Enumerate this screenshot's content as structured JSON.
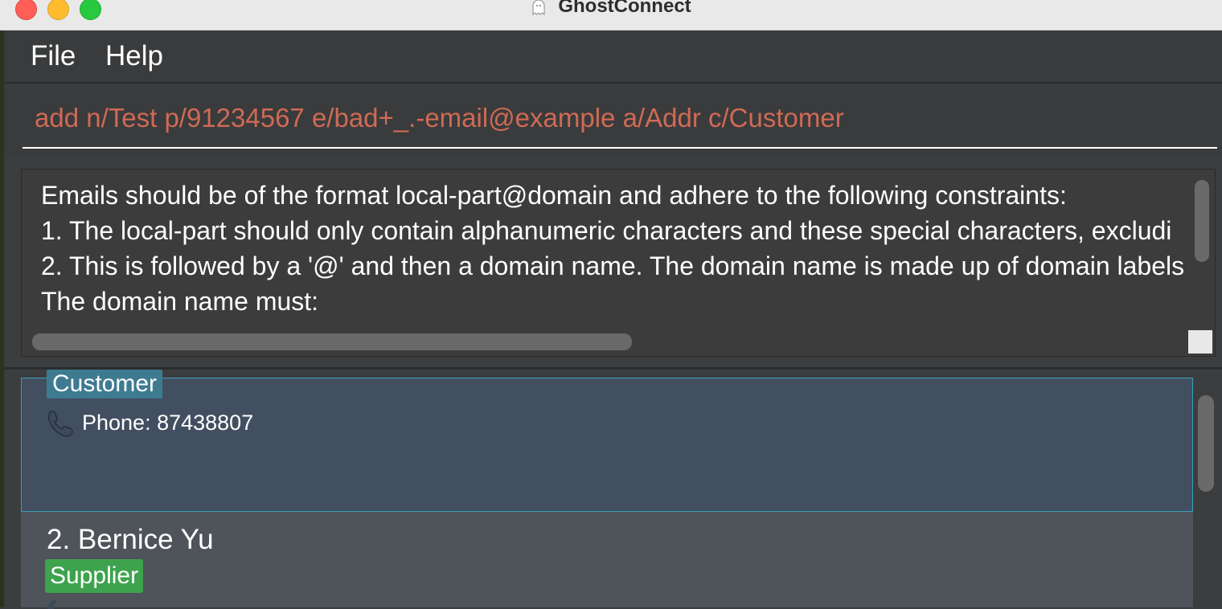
{
  "window": {
    "title": "GhostConnect"
  },
  "menu": {
    "file": "File",
    "help": "Help"
  },
  "command": {
    "value": "add n/Test p/91234567 e/bad+_.-email@example a/Addr c/Customer"
  },
  "result": {
    "lines": [
      "Emails should be of the format local-part@domain and adhere to the following constraints:",
      "1. The local-part should only contain alphanumeric characters and these special characters, excludi",
      "2. This is followed by a '@' and then a domain name. The domain name is made up of domain labels",
      "The domain name must:"
    ]
  },
  "persons": [
    {
      "tag": "Customer",
      "phone": "Phone: 87438807"
    },
    {
      "name": "2. Bernice Yu",
      "tag": "Supplier"
    }
  ],
  "colors": {
    "command_text": "#cf6a55",
    "customer_tag": "#3e7b91",
    "supplier_tag": "#3da34d",
    "selected_card": "#424f60"
  }
}
